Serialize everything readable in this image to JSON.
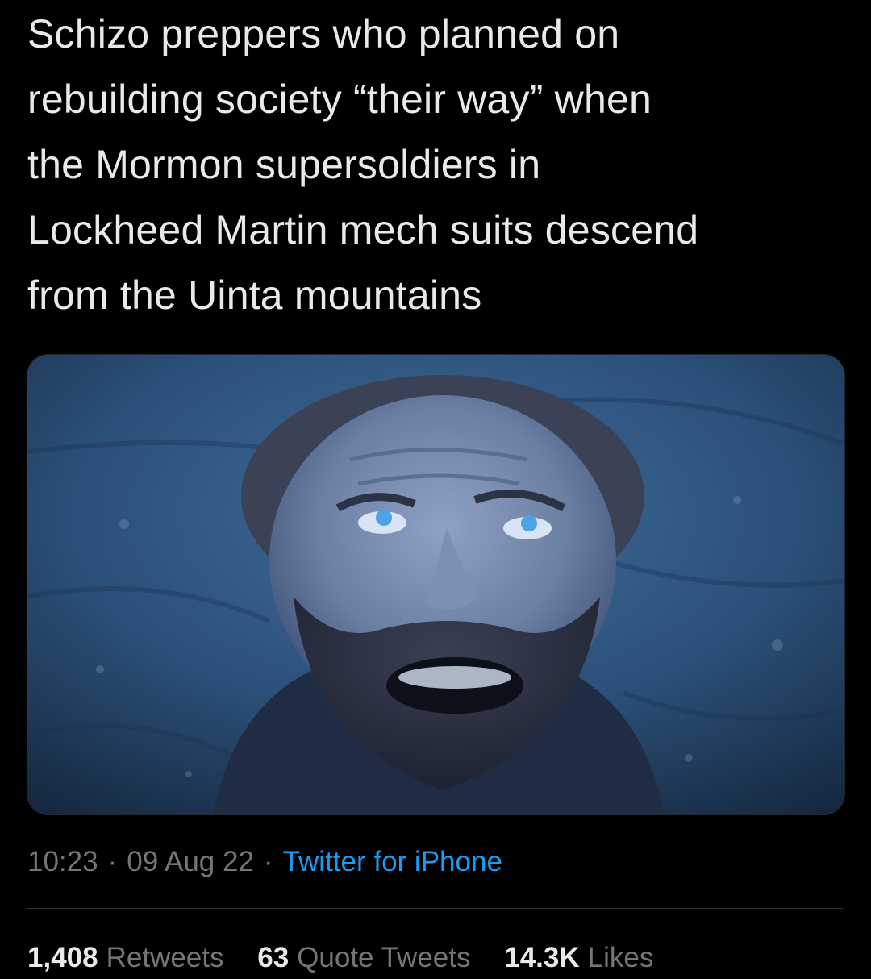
{
  "tweet": {
    "text": "Schizo preppers who planned on\nrebuilding society “their way” when\nthe Mormon supersoldiers in\nLockheed Martin mech suits descend\nfrom the Uinta mountains",
    "media": {
      "icon": "photo-man-looking-up"
    },
    "meta": {
      "time": "10:23",
      "separator": "·",
      "date": "09 Aug 22",
      "source": "Twitter for iPhone"
    },
    "stats": {
      "retweets_count": "1,408",
      "retweets_label": "Retweets",
      "quotes_count": "63",
      "quotes_label": "Quote Tweets",
      "likes_count": "14.3K",
      "likes_label": "Likes"
    }
  },
  "colors": {
    "background": "#000000",
    "text": "#e7e9ea",
    "muted": "#71767b",
    "link": "#1d9bf0",
    "divider": "#2f3336"
  }
}
